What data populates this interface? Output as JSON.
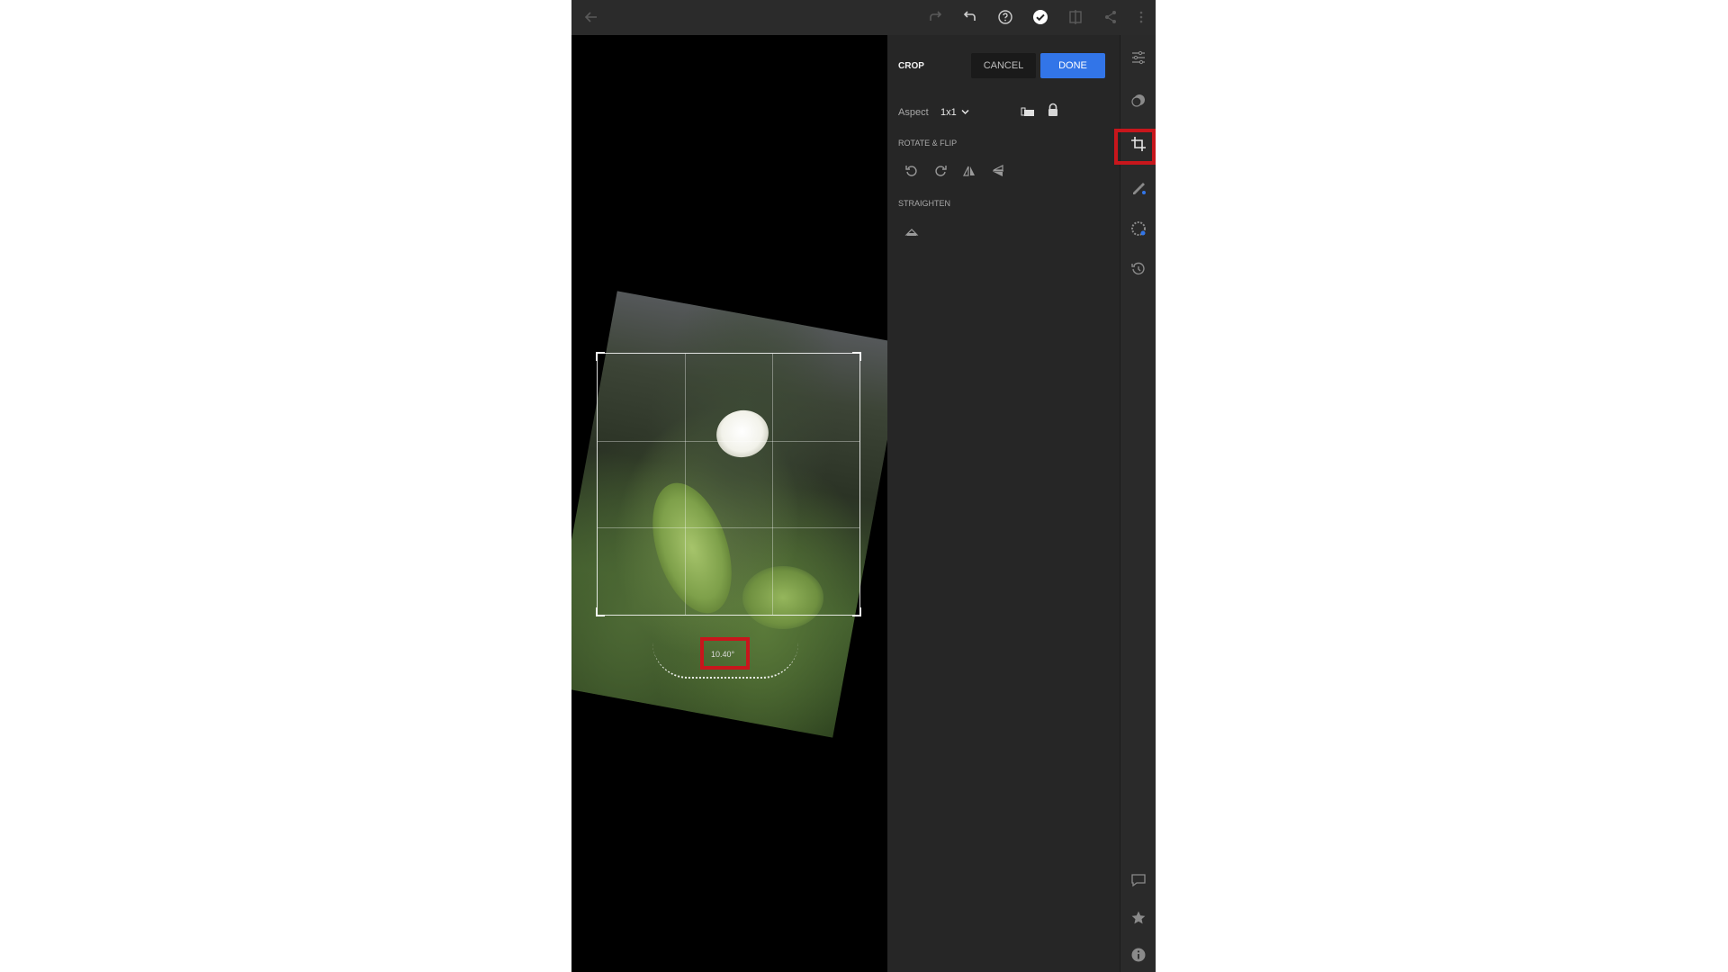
{
  "panel": {
    "title": "CROP",
    "cancel_label": "CANCEL",
    "done_label": "DONE",
    "aspect_label": "Aspect",
    "aspect_value": "1x1",
    "rotate_flip_label": "ROTATE & FLIP",
    "straighten_label": "STRAIGHTEN"
  },
  "canvas": {
    "angle_readout": "10.40°"
  },
  "colors": {
    "accent": "#3275e8",
    "highlight": "#c8161c"
  }
}
